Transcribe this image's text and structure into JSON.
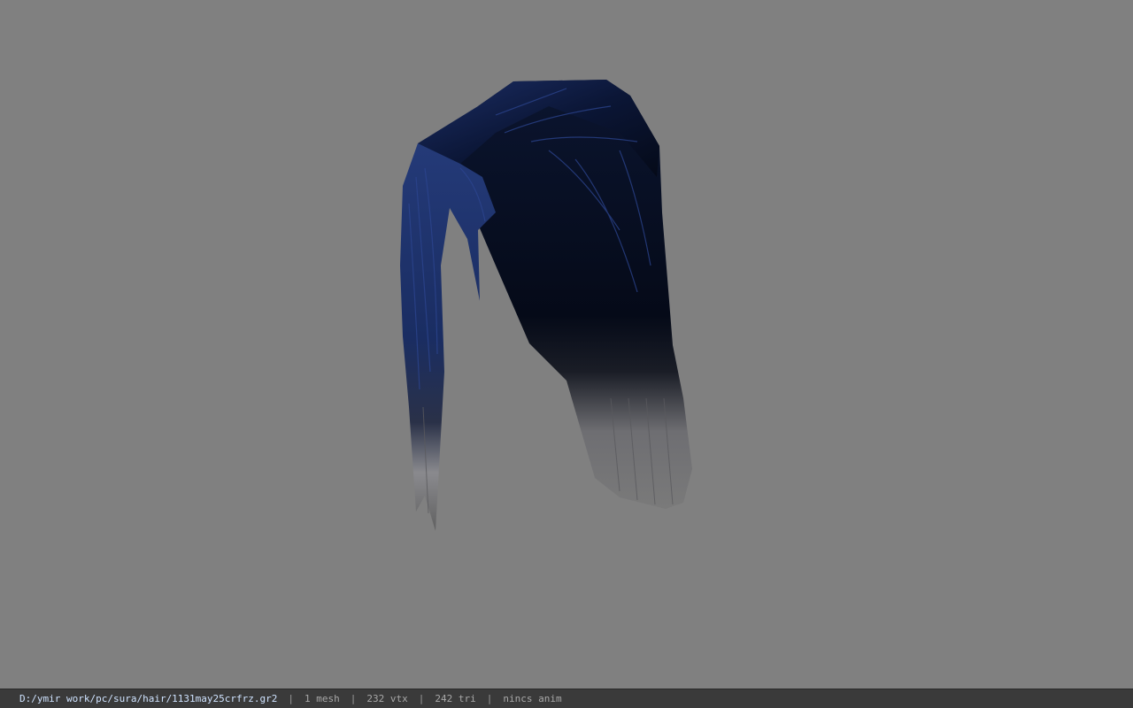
{
  "viewport": {
    "background": "#808080",
    "model": {
      "kind": "hair-mesh",
      "hair_color_top": "#0a1228",
      "hair_color_highlight": "#2a3f7a",
      "hair_color_tip": "#8a8a8a"
    }
  },
  "statusbar": {
    "file_path": "D:/ymir work/pc/sura/hair/1131may25crfrz.gr2",
    "separator": "|",
    "mesh_count": "1 mesh",
    "vertex_count": "232 vtx",
    "triangle_count": "242 tri",
    "anim_status": "nincs anim"
  }
}
